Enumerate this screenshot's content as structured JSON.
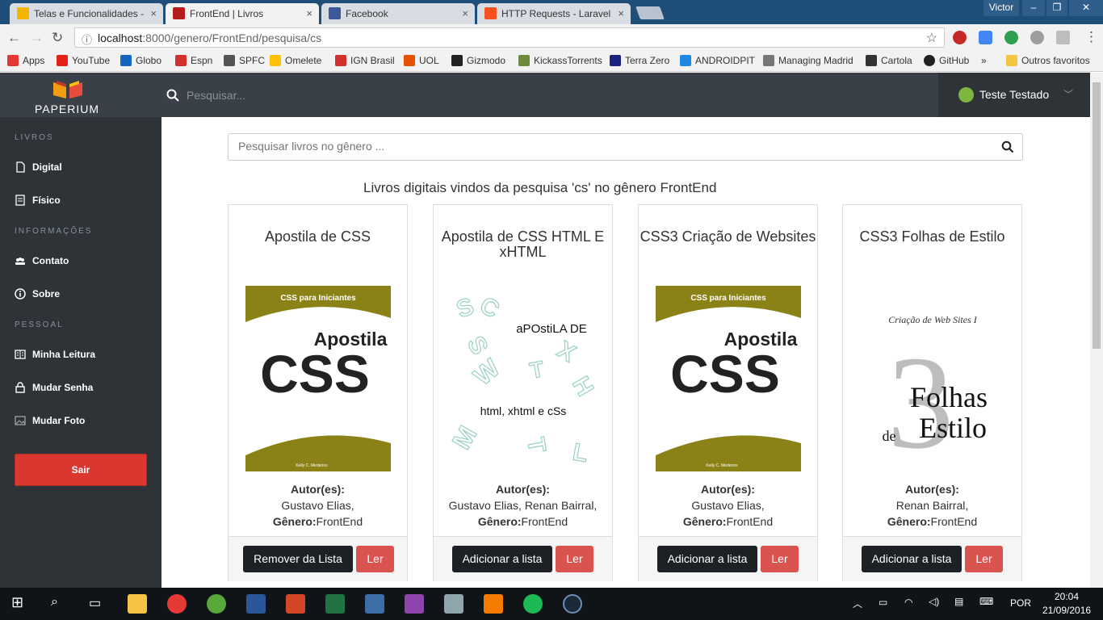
{
  "browser": {
    "tabs": [
      {
        "title": "Telas e Funcionalidades -",
        "color": "#f4b400"
      },
      {
        "title": "FrontEnd | Livros",
        "color": "#b71c1c"
      },
      {
        "title": "Facebook",
        "color": "#3b5998"
      },
      {
        "title": "HTTP Requests - Laravel",
        "color": "#f4511e"
      }
    ],
    "close_glyph": "×",
    "window_user": "Victor",
    "url_host": "localhost",
    "url_path": ":8000/genero/FrontEnd/pesquisa/cs",
    "bookmarks": [
      {
        "label": "Apps",
        "color": "#e53935"
      },
      {
        "label": "YouTube",
        "color": "#e62117"
      },
      {
        "label": "Globo",
        "color": "#1565c0"
      },
      {
        "label": "Espn",
        "color": "#d32f2f"
      },
      {
        "label": "SPFC",
        "color": "#555555"
      },
      {
        "label": "Omelete",
        "color": "#ffc107"
      },
      {
        "label": "IGN Brasil",
        "color": "#d32f2f"
      },
      {
        "label": "UOL",
        "color": "#e65100"
      },
      {
        "label": "Gizmodo",
        "color": "#222222"
      },
      {
        "label": "KickassTorrents",
        "color": "#6d8b3a"
      },
      {
        "label": "Terra Zero",
        "color": "#1a237e"
      },
      {
        "label": "ANDROIDPIT",
        "color": "#1e88e5"
      },
      {
        "label": "Managing Madrid",
        "color": "#777777"
      },
      {
        "label": "Cartola",
        "color": "#333333"
      },
      {
        "label": "GitHub",
        "color": "#222222"
      }
    ],
    "more_bookmarks": "»",
    "other_favorites": "Outros favoritos"
  },
  "sidebar": {
    "brand": "PAPERIUM",
    "sections": [
      {
        "title": "LIVROS",
        "items": [
          "Digital",
          "Físico"
        ]
      },
      {
        "title": "INFORMAÇÕES",
        "items": [
          "Contato",
          "Sobre"
        ]
      },
      {
        "title": "PESSOAL",
        "items": [
          "Minha Leitura",
          "Mudar Senha",
          "Mudar Foto"
        ]
      }
    ],
    "logout_label": "Sair"
  },
  "topbar": {
    "search_placeholder": "Pesquisar...",
    "user_name": "Teste Testado"
  },
  "main": {
    "search_placeholder": "Pesquisar livros no gênero ...",
    "heading": "Livros digitais vindos da pesquisa 'cs' no gênero FrontEnd",
    "author_label": "Autor(es):",
    "genre_label": "Gênero:",
    "read_label": "Ler",
    "books": [
      {
        "title": "Apostila de CSS",
        "authors": "Gustavo Elias,",
        "genre": "FrontEnd",
        "action": "Remover da Lista",
        "cover": "olive",
        "cover_top": "CSS para Iniciantes",
        "cover_mid": "Apostila",
        "cover_big": "CSS",
        "cover_foot": "Kelly C. Medeiros"
      },
      {
        "title": "Apostila de CSS HTML E xHTML",
        "authors": "Gustavo Elias, Renan Bairral,",
        "genre": "FrontEnd",
        "action": "Adicionar a lista",
        "cover": "letters",
        "cover_top": "aPOstiLA DE",
        "cover_mid": "html, xhtml e cSs",
        "cover_big": "",
        "cover_foot": ""
      },
      {
        "title": "CSS3 Criação de Websites",
        "authors": "Gustavo Elias,",
        "genre": "FrontEnd",
        "action": "Adicionar a lista",
        "cover": "olive",
        "cover_top": "CSS para Iniciantes",
        "cover_mid": "Apostila",
        "cover_big": "CSS",
        "cover_foot": "Kelly C. Medeiros"
      },
      {
        "title": "CSS3 Folhas de Estilo",
        "authors": "Renan Bairral,",
        "genre": "FrontEnd",
        "action": "Adicionar a lista",
        "cover": "three",
        "cover_top": "Criação de Web Sites I",
        "cover_mid": "Folhas",
        "cover_big": "3",
        "cover_foot": "Estilo",
        "cover_de": "de"
      }
    ]
  },
  "taskbar": {
    "language": "POR",
    "time": "20:04",
    "date": "21/09/2016"
  }
}
